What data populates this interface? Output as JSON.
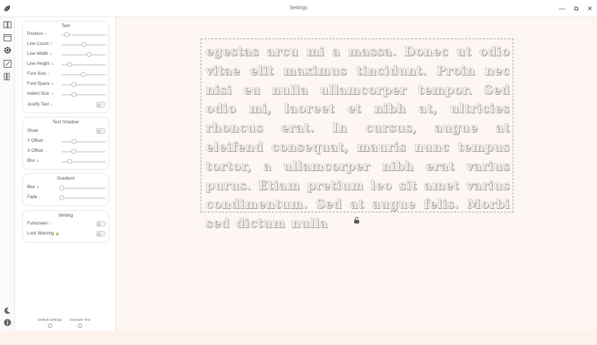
{
  "window": {
    "title": "Settings",
    "minimize": "—",
    "maximize": "⧉",
    "close": "✕"
  },
  "rail": {
    "icons": [
      "leaf-logo-icon",
      "book-icon",
      "calendar-icon",
      "gear-icon",
      "edit-icon",
      "library-icon",
      "moon-icon",
      "info-icon"
    ]
  },
  "sections": {
    "text": {
      "title": "Text",
      "position": {
        "label": "Position",
        "hint": "⇕",
        "value": 0.12
      },
      "line_count": {
        "label": "Line Count",
        "hint": "☰",
        "value": 0.5
      },
      "line_width": {
        "label": "Line Width",
        "hint": "⇄",
        "value": 0.62
      },
      "line_height": {
        "label": "Line Height",
        "hint": "⇅",
        "value": 0.18
      },
      "font_size": {
        "label": "Font Size",
        "hint": "↗",
        "value": 0.48
      },
      "font_space": {
        "label": "Font Space",
        "hint": "⊕",
        "value": 0.28
      },
      "indent_size": {
        "label": "Indent Size",
        "hint": "⇥",
        "value": 0.28
      },
      "justify": {
        "label": "Justify Text",
        "hint": "≡"
      }
    },
    "shadow": {
      "title": "Text Shadow",
      "show": {
        "label": "Show",
        "hint": "◌"
      },
      "y_offset": {
        "label": "Y Offset",
        "hint": "↕",
        "value": 0.28
      },
      "x_offset": {
        "label": "X Offset",
        "hint": "↔",
        "value": 0.28
      },
      "blur": {
        "label": "Blur",
        "hint": "◍",
        "value": 0.18
      }
    },
    "gradient": {
      "title": "Gradient",
      "blur": {
        "label": "Blur",
        "hint": "◍",
        "value": 0.0
      },
      "fade": {
        "label": "Fade",
        "hint": "◐",
        "value": 0.0
      }
    },
    "writing": {
      "title": "Writing",
      "fullscreen": {
        "label": "Fullscreen",
        "hint": "▢"
      },
      "lock_warning": {
        "label": "Lock Warning",
        "hint": "🔒"
      }
    }
  },
  "footer": {
    "default_settings": "Default Settings",
    "example_text": "Example Text"
  },
  "editor": {
    "text": "egestas arcu mi a massa. Donec ut odio vitae elit maximus tincidunt. Proin nec nisi eu nulla ullamcorper tempor. Sed odio mi, laoreet et nibh at, ultricies rhoncus erat. In cursus, augue at eleifend consequat, mauris nunc tempus tortor, a ullamcorper nibh erat varius purus. Etiam pretium leo sit amet varius condimentum. Sed at augue felis. Morbi sed dictum nulla"
  }
}
